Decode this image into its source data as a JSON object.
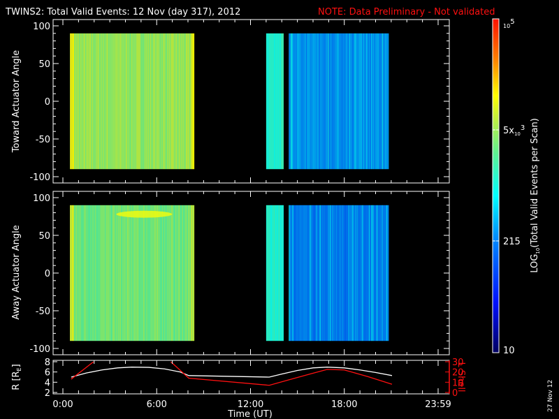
{
  "title": {
    "main": "TWINS2: Total Valid Events: 12 Nov (day 317), 2012",
    "note": "NOTE: Data Preliminary - Not validated",
    "note_color": "#ff1010"
  },
  "chart_data": [
    {
      "type": "heatmap",
      "name": "toward",
      "ylabel": "Toward Actuator Angle",
      "ylim": [
        -100,
        100
      ],
      "yticks": [
        "100",
        "50",
        "0",
        "-50",
        "-100"
      ],
      "angle_range": [
        -90,
        90
      ],
      "xlim_hours": [
        0,
        24
      ],
      "data_blocks_hours": [
        [
          0.45,
          8.4
        ],
        [
          13.0,
          14.1
        ],
        [
          14.45,
          20.8
        ]
      ],
      "block_levels": [
        0.66,
        0.52,
        0.36
      ]
    },
    {
      "type": "heatmap",
      "name": "away",
      "ylabel": "Away Actuator Angle",
      "ylim": [
        -100,
        100
      ],
      "yticks": [
        "100",
        "50",
        "0",
        "-50",
        "-100"
      ],
      "angle_range": [
        -90,
        90
      ],
      "xlim_hours": [
        0,
        24
      ],
      "data_blocks_hours": [
        [
          0.45,
          8.4
        ],
        [
          13.0,
          14.1
        ],
        [
          14.45,
          20.8
        ]
      ],
      "block_levels": [
        0.62,
        0.52,
        0.33
      ]
    },
    {
      "type": "line",
      "name": "orbit",
      "xlabel": "Time (UT)",
      "xticks": [
        "0:00",
        "6:00",
        "12:00",
        "18:00",
        "23:59"
      ],
      "ylabel_left": "R [R",
      "ylabel_left_sub": "E",
      "ylabel_left_close": "]",
      "ylim_left": [
        2,
        8
      ],
      "yticks_left": [
        "8",
        "6",
        "4",
        "2"
      ],
      "ylabel_right": "L Shell",
      "ylim_right": [
        0,
        30
      ],
      "yticks_right": [
        "30",
        "20",
        "10",
        "0"
      ],
      "series": [
        {
          "name": "R",
          "color": "#ffffff",
          "x": [
            0.53,
            1.5,
            2.5,
            3.5,
            4.4,
            5.5,
            6.5,
            7.5,
            8.05,
            13.2,
            14.0,
            15.0,
            16.0,
            16.9,
            18.0,
            19.0,
            20.0,
            21.05
          ],
          "y": [
            5.0,
            5.8,
            6.4,
            6.8,
            6.95,
            6.9,
            6.6,
            6.0,
            5.3,
            5.0,
            5.6,
            6.3,
            6.8,
            6.95,
            6.8,
            6.4,
            5.9,
            5.3
          ]
        },
        {
          "name": "L Shell",
          "color": "#ff1010",
          "segments": [
            {
              "x": [
                0.53,
                1.96
              ],
              "y": [
                13,
                30
              ]
            },
            {
              "x": [
                6.9,
                8.05,
                13.2,
                14.5,
                15.8,
                16.9,
                18.0,
                19.5,
                21.05
              ],
              "y": [
                30,
                14,
                7,
                12.5,
                18,
                22.5,
                22,
                15.5,
                8
              ]
            }
          ]
        }
      ]
    }
  ],
  "colorbar": {
    "label": "LOG",
    "label_sub": "10",
    "label_rest": "(Total Valid Events per Scan)",
    "ticks": [
      {
        "base": "10",
        "exp": "5",
        "value": 100000
      },
      {
        "base": "5x",
        "sub": "10",
        "exp": "3",
        "value": 5000
      },
      {
        "base": "215",
        "value": 215
      },
      {
        "base": "10",
        "value": 10
      }
    ],
    "range": [
      10,
      100000
    ]
  },
  "date_stamp": "27 Nov 12"
}
